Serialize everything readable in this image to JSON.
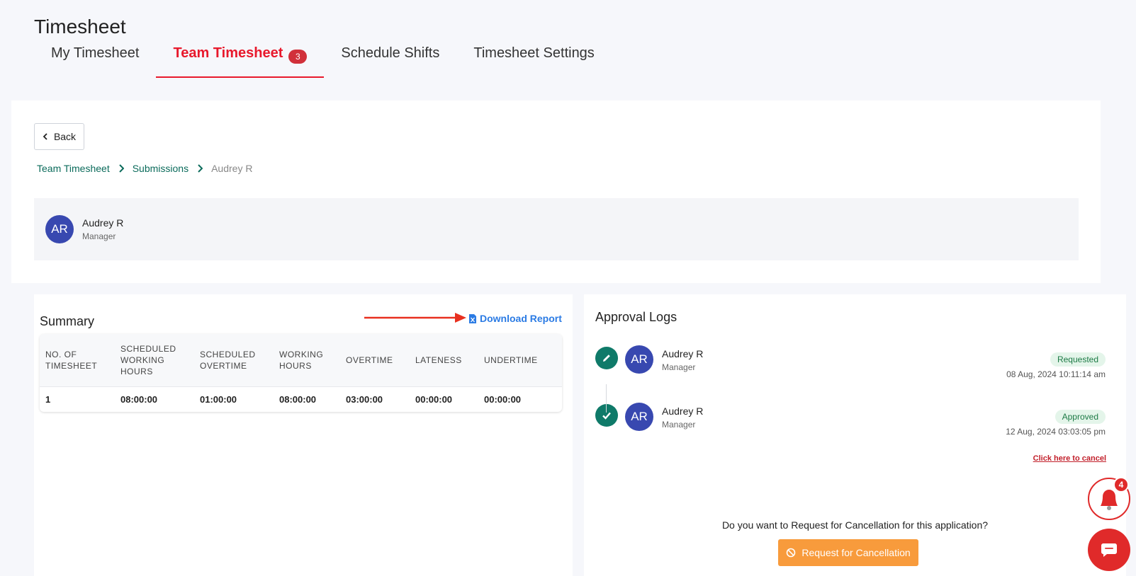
{
  "page": {
    "title": "Timesheet"
  },
  "tabs": [
    {
      "label": "My Timesheet",
      "active": false
    },
    {
      "label": "Team Timesheet",
      "active": true,
      "badge": "3"
    },
    {
      "label": "Schedule Shifts",
      "active": false
    },
    {
      "label": "Timesheet Settings",
      "active": false
    }
  ],
  "back": {
    "label": "Back"
  },
  "breadcrumb": {
    "items": [
      "Team Timesheet",
      "Submissions"
    ],
    "current": "Audrey R"
  },
  "employee": {
    "initials": "AR",
    "name": "Audrey R",
    "role": "Manager"
  },
  "summary": {
    "title": "Summary",
    "download_label": "Download Report",
    "columns": [
      "NO. OF TIMESHEET",
      "SCHEDULED WORKING HOURS",
      "SCHEDULED OVERTIME",
      "WORKING HOURS",
      "OVERTIME",
      "LATENESS",
      "UNDERTIME"
    ],
    "rows": [
      [
        "1",
        "08:00:00",
        "01:00:00",
        "08:00:00",
        "03:00:00",
        "00:00:00",
        "00:00:00"
      ]
    ]
  },
  "approval": {
    "title": "Approval Logs",
    "logs": [
      {
        "icon": "pencil-icon",
        "initials": "AR",
        "name": "Audrey R",
        "role": "Manager",
        "status": "Requested",
        "time": "08 Aug, 2024 10:11:14 am"
      },
      {
        "icon": "check-icon",
        "initials": "AR",
        "name": "Audrey R",
        "role": "Manager",
        "status": "Approved",
        "time": "12 Aug, 2024 03:03:05 pm"
      }
    ],
    "cancel_link": "Click here to cancel",
    "cancel_question": "Do you want to Request for Cancellation for this application?",
    "cancel_button": "Request for Cancellation"
  },
  "notifications": {
    "count": "4"
  },
  "colors": {
    "accent": "#e8192c",
    "link": "#0b6b5b",
    "download": "#2b7be4",
    "avatar": "#3848b0",
    "log_icon": "#0f7a69",
    "cancel_button": "#f89b3c"
  }
}
